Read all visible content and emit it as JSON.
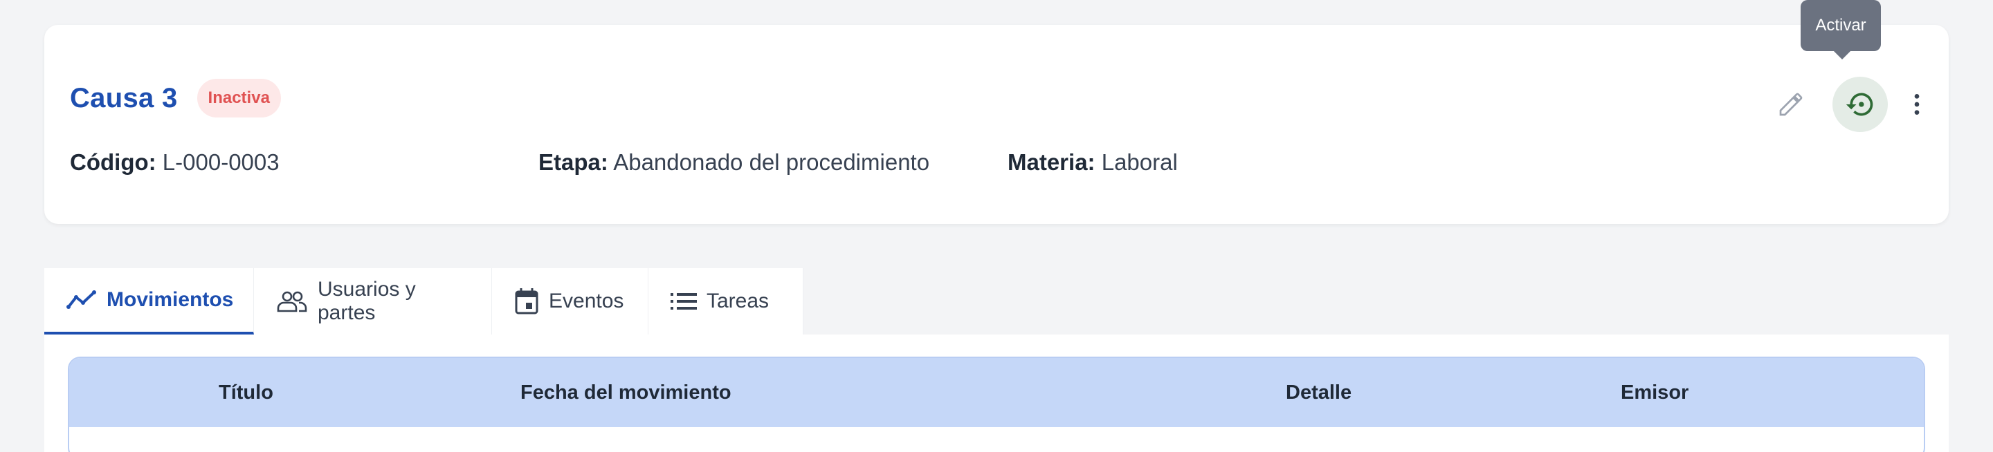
{
  "case": {
    "title": "Causa 3",
    "status": "Inactiva",
    "codigo_label": "Código:",
    "codigo_value": "L-000-0003",
    "etapa_label": "Etapa:",
    "etapa_value": "Abandonado del procedimiento",
    "materia_label": "Materia:",
    "materia_value": "Laboral"
  },
  "actions": {
    "edit_icon": "pencil-icon",
    "activate_icon": "restore-icon",
    "more_icon": "more-vert-icon",
    "tooltip": "Activar"
  },
  "tabs": [
    {
      "label": "Movimientos",
      "icon": "trending-line-icon",
      "active": true
    },
    {
      "label": "Usuarios y partes",
      "icon": "people-icon",
      "active": false
    },
    {
      "label": "Eventos",
      "icon": "calendar-icon",
      "active": false
    },
    {
      "label": "Tareas",
      "icon": "list-icon",
      "active": false
    }
  ],
  "table": {
    "columns": [
      "Título",
      "Fecha del movimiento",
      "Detalle",
      "Emisor"
    ]
  },
  "colors": {
    "brand_blue": "#1e4fb0",
    "badge_bg": "#fde8e8",
    "badge_text": "#e05252",
    "activate_green": "#2e6b35",
    "table_header_bg": "#c5d7f8"
  }
}
